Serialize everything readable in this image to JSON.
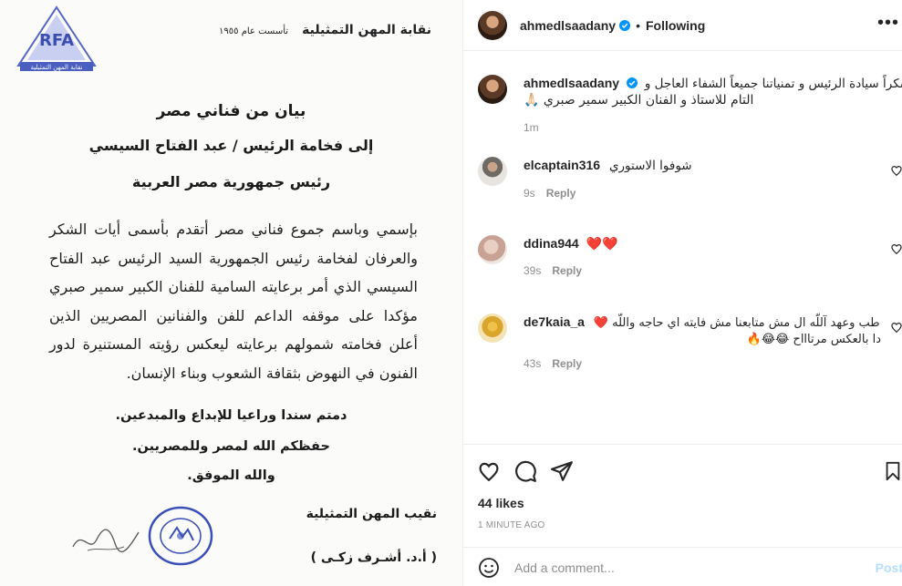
{
  "document": {
    "org_name": "نقابة المهن التمثيلية",
    "established": "تأسست عام ١٩٥٥",
    "logo_text": "نقابة المهن التمثيلية",
    "title_1": "بيان من فناني مصر",
    "title_2": "إلى فخامة الرئيس / عبد الفتاح السيسي",
    "title_3": "رئيس جمهورية مصر العربية",
    "body": "بإسمي وباسم جموع فناني مصر أتقدم بأسمى أيات الشكر والعرفان لفخامة رئيس الجمهورية السيد الرئيس عبد الفتاح السيسي الذي أمر برعايته السامية للفنان الكبير سمير صبري مؤكدا على موقفه الداعم للفن والفنانين المصريين الذين أعلن فخامته شمولهم برعايته ليعكس رؤيته المستنيرة لدور الفنون في النهوض بثقافة الشعوب وبناء الإنسان.",
    "closing_1": "دمتم سندا وراعيا للإبداع والمبدعين.",
    "closing_2": "حفظكم الله لمصر وللمصريين.",
    "closing_3": "والله الموفق.",
    "sign_title": "نقيب المهن التمثيلية",
    "sign_name": "( أ.د. أشـرف زكـى )"
  },
  "header": {
    "username": "ahmedlsaadany",
    "separator": "•",
    "follow_label": "Following",
    "more_label": "•••"
  },
  "caption": {
    "username": "ahmedlsaadany",
    "text_line1": "شكراً سيادة الرئيس و تمنياتنا جميعاً الشفاء العاجل و",
    "text_line2": "التام للاستاذ و الفنان الكبير سمير صبري 🙏🏻",
    "time": "1m"
  },
  "comments": [
    {
      "username": "elcaptain316",
      "text": "شوفوا الاستوري",
      "time": "9s",
      "reply_label": "Reply"
    },
    {
      "username": "ddina944",
      "text": "❤️❤️",
      "time": "39s",
      "reply_label": "Reply"
    },
    {
      "username": "de7kaia_a",
      "text": "طب وعهد آللّه ال مش متابعنا مش فايته اي حاجه واللّه ❤️",
      "text_line2": "دا بالعكس مرتاااح 😂😂🔥",
      "time": "43s",
      "reply_label": "Reply"
    }
  ],
  "actions": {
    "likes": "44 likes",
    "time_ago": "1 MINUTE AGO"
  },
  "add_comment": {
    "placeholder": "Add a comment...",
    "post_label": "Post"
  },
  "colors": {
    "accent": "#0095f6",
    "post_disabled": "#b2dffc",
    "heart_red": "#ed4956",
    "muted": "#8e8e8e",
    "stamp_blue": "#3a4fb8",
    "logo_blue": "#4a5fc0"
  }
}
